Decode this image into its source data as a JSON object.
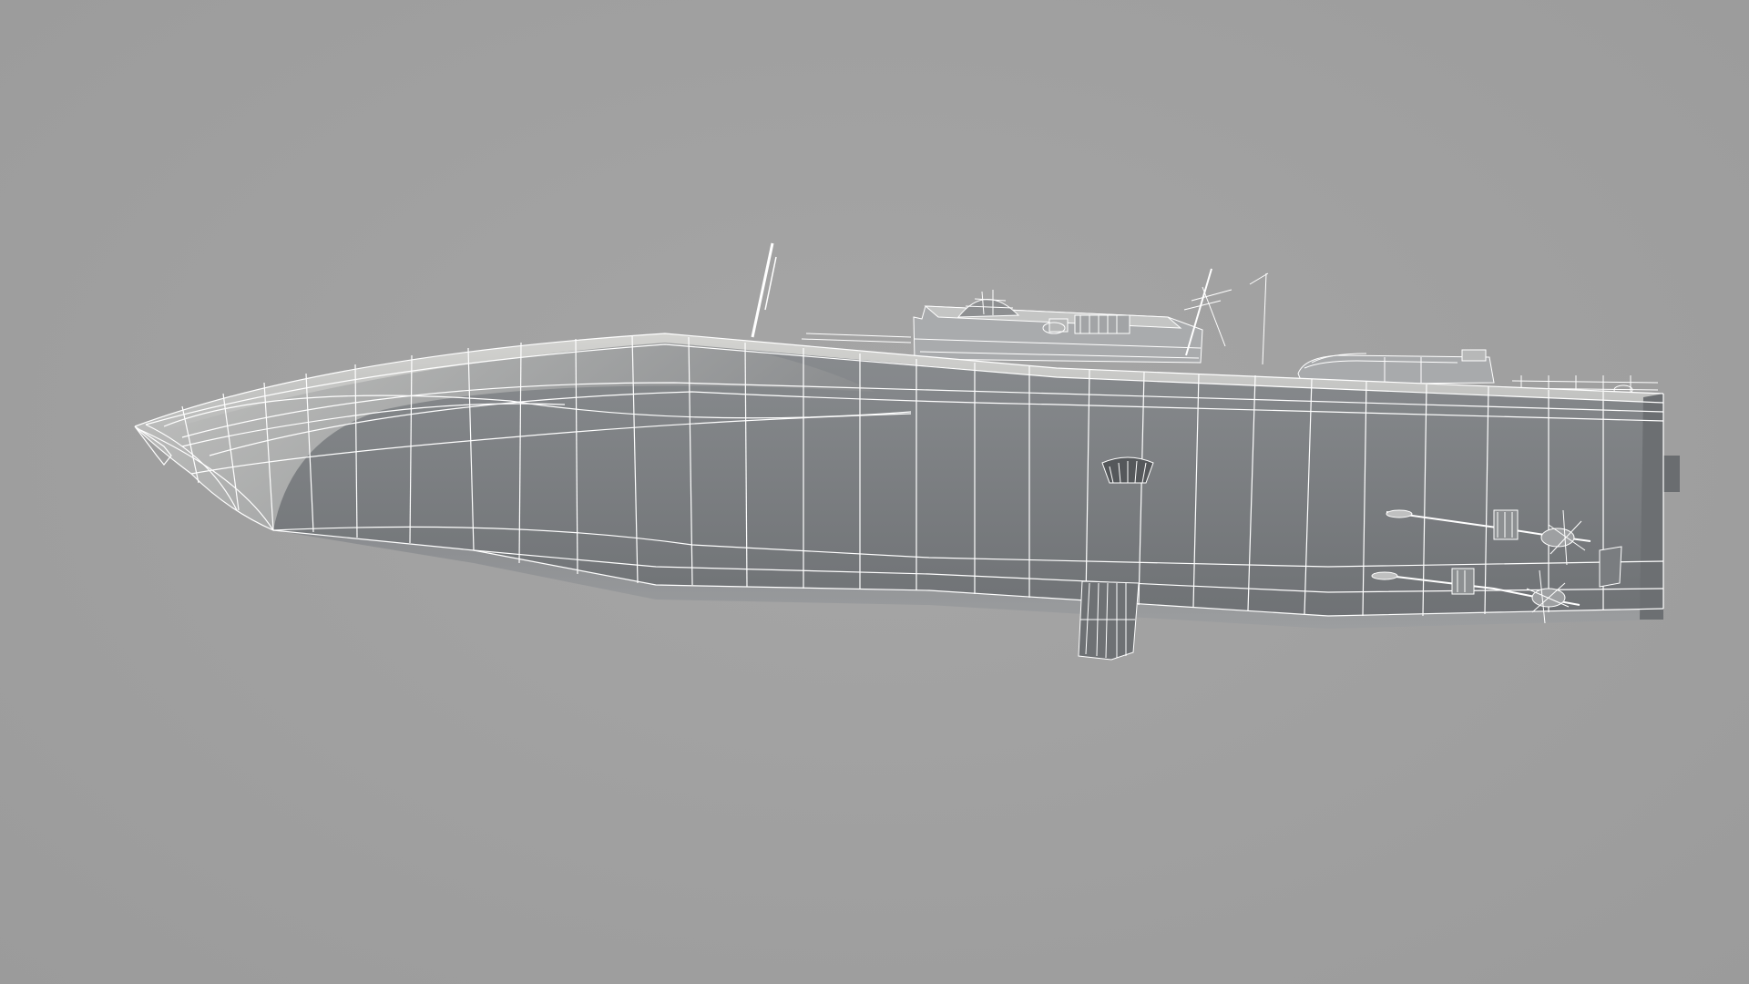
{
  "scene": {
    "subject": "wireframe-ship-model",
    "background_color": "#a0a0a0",
    "hull_color": "#7e8184",
    "wire_color": "#ffffff"
  }
}
